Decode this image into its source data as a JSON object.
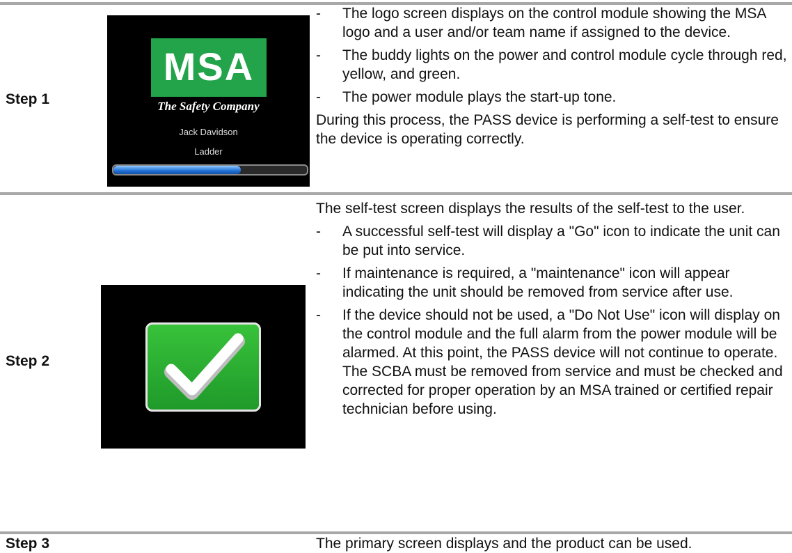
{
  "step1": {
    "label": "Step 1",
    "screen": {
      "logo": "MSA",
      "tagline": "The Safety Company",
      "user_name": "Jack Davidson",
      "team_name": "Ladder",
      "progress": 0.66,
      "logo_color": "#23a34a"
    },
    "bullets": [
      "The logo screen displays on the control module showing the MSA logo and a user and/or team name if assigned to the device.",
      "The buddy lights on the power and control module cycle through red, yellow, and green.",
      "The power module plays the start-up tone."
    ],
    "note": "During this process, the PASS device is performing a self-test to ensure the device is operating correctly."
  },
  "step2": {
    "label": "Step 2",
    "screen": {
      "icon": "check-icon",
      "icon_color": "#2db634"
    },
    "intro": "The self-test screen displays the results of the self-test to the user.",
    "bullets": [
      "A successful self-test will display a \"Go\" icon to indicate the unit can be put into service.",
      "If maintenance is required, a \"maintenance\" icon will appear indicating the unit should be removed from service after use.",
      "If the device should not be used, a \"Do Not Use\" icon will display on the control module and the full alarm from the power module will be alarmed. At this point, the PASS device will not continue to operate. The SCBA must be removed from service and must be checked and corrected for proper operation by an MSA trained or certified repair technician before using."
    ]
  },
  "step3": {
    "label": "Step 3",
    "text": "The primary screen displays and the product can be used."
  },
  "bullet_dash": "-"
}
